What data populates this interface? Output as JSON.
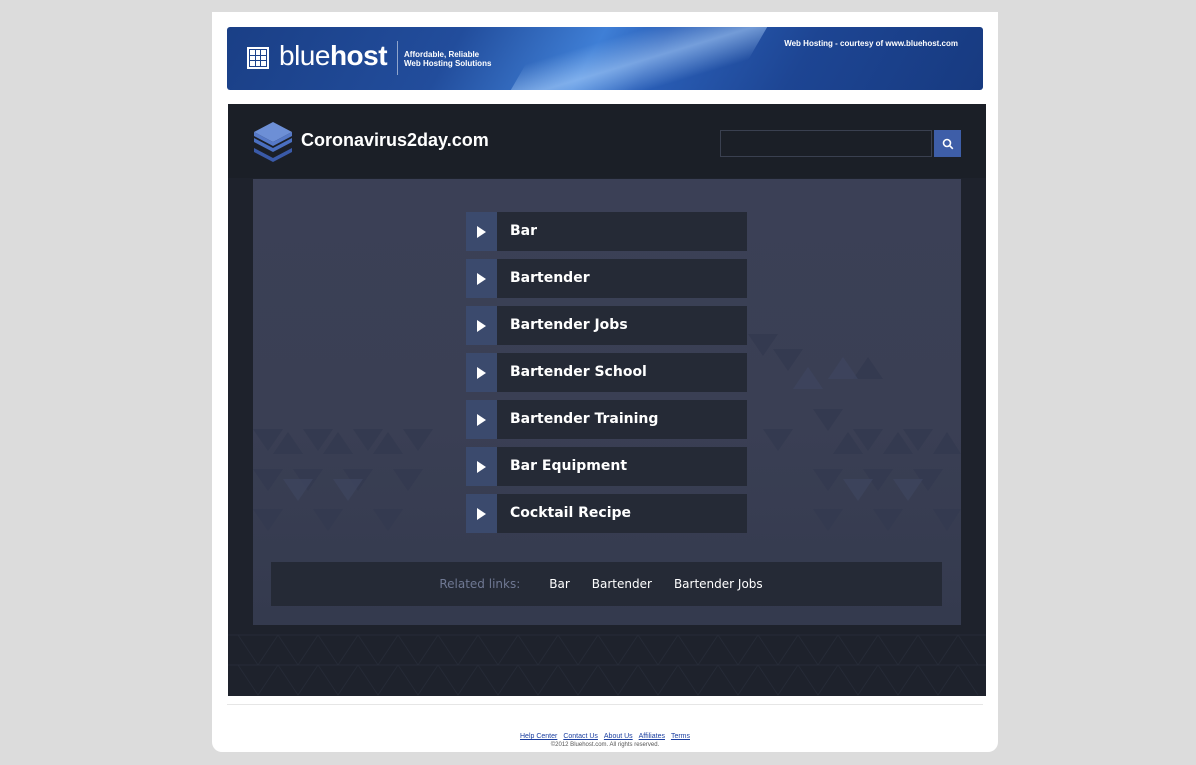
{
  "banner": {
    "logo_light": "blue",
    "logo_bold": "host",
    "tagline_line1": "Affordable, Reliable",
    "tagline_line2": "Web Hosting Solutions",
    "courtesy": "Web Hosting - courtesy of www.bluehost.com"
  },
  "site": {
    "title": "Coronavirus2day.com",
    "search": {
      "value": "",
      "placeholder": ""
    }
  },
  "links": [
    {
      "label": "Bar"
    },
    {
      "label": "Bartender"
    },
    {
      "label": "Bartender Jobs"
    },
    {
      "label": "Bartender School"
    },
    {
      "label": "Bartender Training"
    },
    {
      "label": "Bar Equipment"
    },
    {
      "label": "Cocktail Recipe"
    }
  ],
  "related": {
    "label": "Related links:",
    "items": [
      "Bar",
      "Bartender",
      "Bartender Jobs"
    ]
  },
  "footer": {
    "links": [
      "Help Center",
      "Contact Us",
      "About Us",
      "Affiliates",
      "Terms"
    ],
    "copyright": "©2012 Bluehost.com. All rights reserved."
  },
  "colors": {
    "banner_blue": "#1d4593",
    "site_dark": "#1e222c",
    "panel": "#3a3f54",
    "accent": "#3e5ea8"
  },
  "icons": {
    "site_logo": "layers-icon",
    "search": "search-icon",
    "link_arrow": "play-arrow-icon",
    "banner_logo": "grid-icon"
  }
}
